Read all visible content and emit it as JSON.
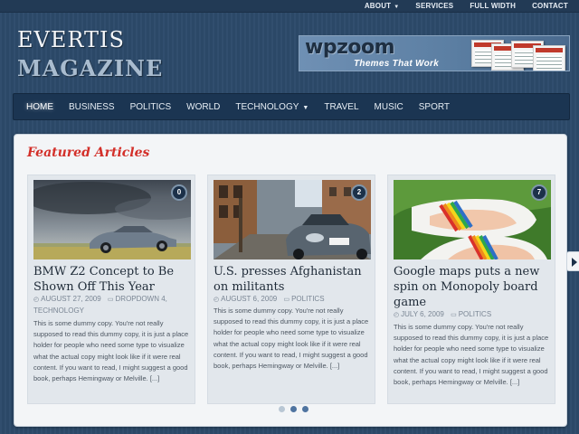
{
  "topnav": {
    "items": [
      {
        "label": "ABOUT",
        "has_dropdown": true
      },
      {
        "label": "SERVICES"
      },
      {
        "label": "FULL WIDTH"
      },
      {
        "label": "CONTACT"
      }
    ]
  },
  "logo": {
    "line1": "EVERTIS",
    "line2": "MAGAZINE"
  },
  "banner": {
    "brand": "wpzoom",
    "tagline": "Themes That Work"
  },
  "mainnav": {
    "items": [
      {
        "label": "HOME",
        "active": true
      },
      {
        "label": "BUSINESS"
      },
      {
        "label": "POLITICS"
      },
      {
        "label": "WORLD"
      },
      {
        "label": "TECHNOLOGY",
        "has_dropdown": true
      },
      {
        "label": "TRAVEL"
      },
      {
        "label": "MUSIC"
      },
      {
        "label": "SPORT"
      }
    ]
  },
  "featured": {
    "heading": "Featured Articles",
    "cards": [
      {
        "count": "0",
        "title": "BMW Z2 Concept to Be Shown Off This Year",
        "date": "AUGUST 27, 2009",
        "category": "DROPDOWN 4, TECHNOLOGY",
        "excerpt": "This is some dummy copy. You're not really supposed to read this dummy copy, it is just a place holder for people who need some type to visualize what the actual copy might look like if it were real content. If you want to read, I might suggest a good book, perhaps Hemingway or Melville.",
        "more": "[...]"
      },
      {
        "count": "2",
        "title": "U.S. presses Afghanistan on militants",
        "date": "AUGUST 6, 2009",
        "category": "POLITICS",
        "excerpt": "This is some dummy copy. You're not really supposed to read this dummy copy, it is just a place holder for people who need some type to visualize what the actual copy might look like if it were real content. If you want to read, I might suggest a good book, perhaps Hemingway or Melville.",
        "more": "[...]"
      },
      {
        "count": "7",
        "title": "Google maps puts a new spin on Monopoly board game",
        "date": "JULY 6, 2009",
        "category": "POLITICS",
        "excerpt": "This is some dummy copy. You're not really supposed to read this dummy copy, it is just a place holder for people who need some type to visualize what the actual copy might look like if it were real content. If you want to read, I might suggest a good book, perhaps Hemingway or Melville.",
        "more": "[...]"
      }
    ],
    "pager": {
      "active_index": 0,
      "count": 3
    }
  },
  "colors": {
    "background": "#2c4a6a",
    "nav_bg": "#1b3552",
    "accent_red": "#d3302a",
    "panel_bg": "#f3f5f7"
  }
}
